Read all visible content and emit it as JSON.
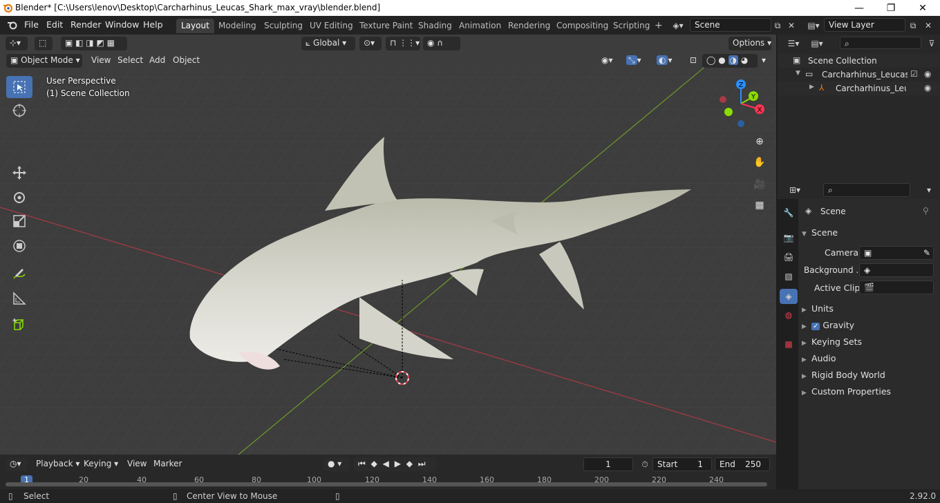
{
  "titlebar": {
    "title": "Blender* [C:\\Users\\lenov\\Desktop\\Carcharhinus_Leucas_Shark_max_vray\\blender.blend]",
    "minimize": "—",
    "maximize": "❐",
    "close": "✕"
  },
  "menu": [
    "File",
    "Edit",
    "Render",
    "Window",
    "Help"
  ],
  "workspaces": [
    "Layout",
    "Modeling",
    "Sculpting",
    "UV Editing",
    "Texture Paint",
    "Shading",
    "Animation",
    "Rendering",
    "Compositing",
    "Scripting"
  ],
  "add_workspace": "+",
  "scene_field": "Scene",
  "view_layer_field": "View Layer",
  "viewport_header": {
    "transform_orientation": "Global",
    "options": "Options",
    "mode": "Object Mode",
    "menus": [
      "View",
      "Select",
      "Add",
      "Object"
    ]
  },
  "viewport_overlay": {
    "line1": "User Perspective",
    "line2": "(1) Scene Collection"
  },
  "gizmo": {
    "z": "Z",
    "y": "Y",
    "x": "X"
  },
  "outliner": {
    "root": "Scene Collection",
    "collection": "Carcharhinus_Leucas_Sh",
    "object": "Carcharhinus_Leucas"
  },
  "properties": {
    "header": "Scene",
    "panel": "Scene",
    "camera_label": "Camera",
    "background_label": "Background ...",
    "active_clip_label": "Active Clip",
    "sections": [
      "Units",
      "Gravity",
      "Keying Sets",
      "Audio",
      "Rigid Body World",
      "Custom Properties"
    ]
  },
  "timeline": {
    "menus": [
      "Playback",
      "Keying",
      "View",
      "Marker"
    ],
    "current_frame": "1",
    "start_label": "Start",
    "start_value": "1",
    "end_label": "End",
    "end_value": "250",
    "ruler": [
      "1",
      "20",
      "40",
      "60",
      "80",
      "100",
      "120",
      "140",
      "160",
      "180",
      "200",
      "220",
      "240"
    ]
  },
  "statusbar": {
    "select": "Select",
    "center_view": "Center View to Mouse",
    "version": "2.92.0"
  },
  "colors": {
    "accent": "#4772b3",
    "x_axis": "#ff3352",
    "y_axis": "#8bdc00",
    "z_axis": "#2890ff"
  }
}
